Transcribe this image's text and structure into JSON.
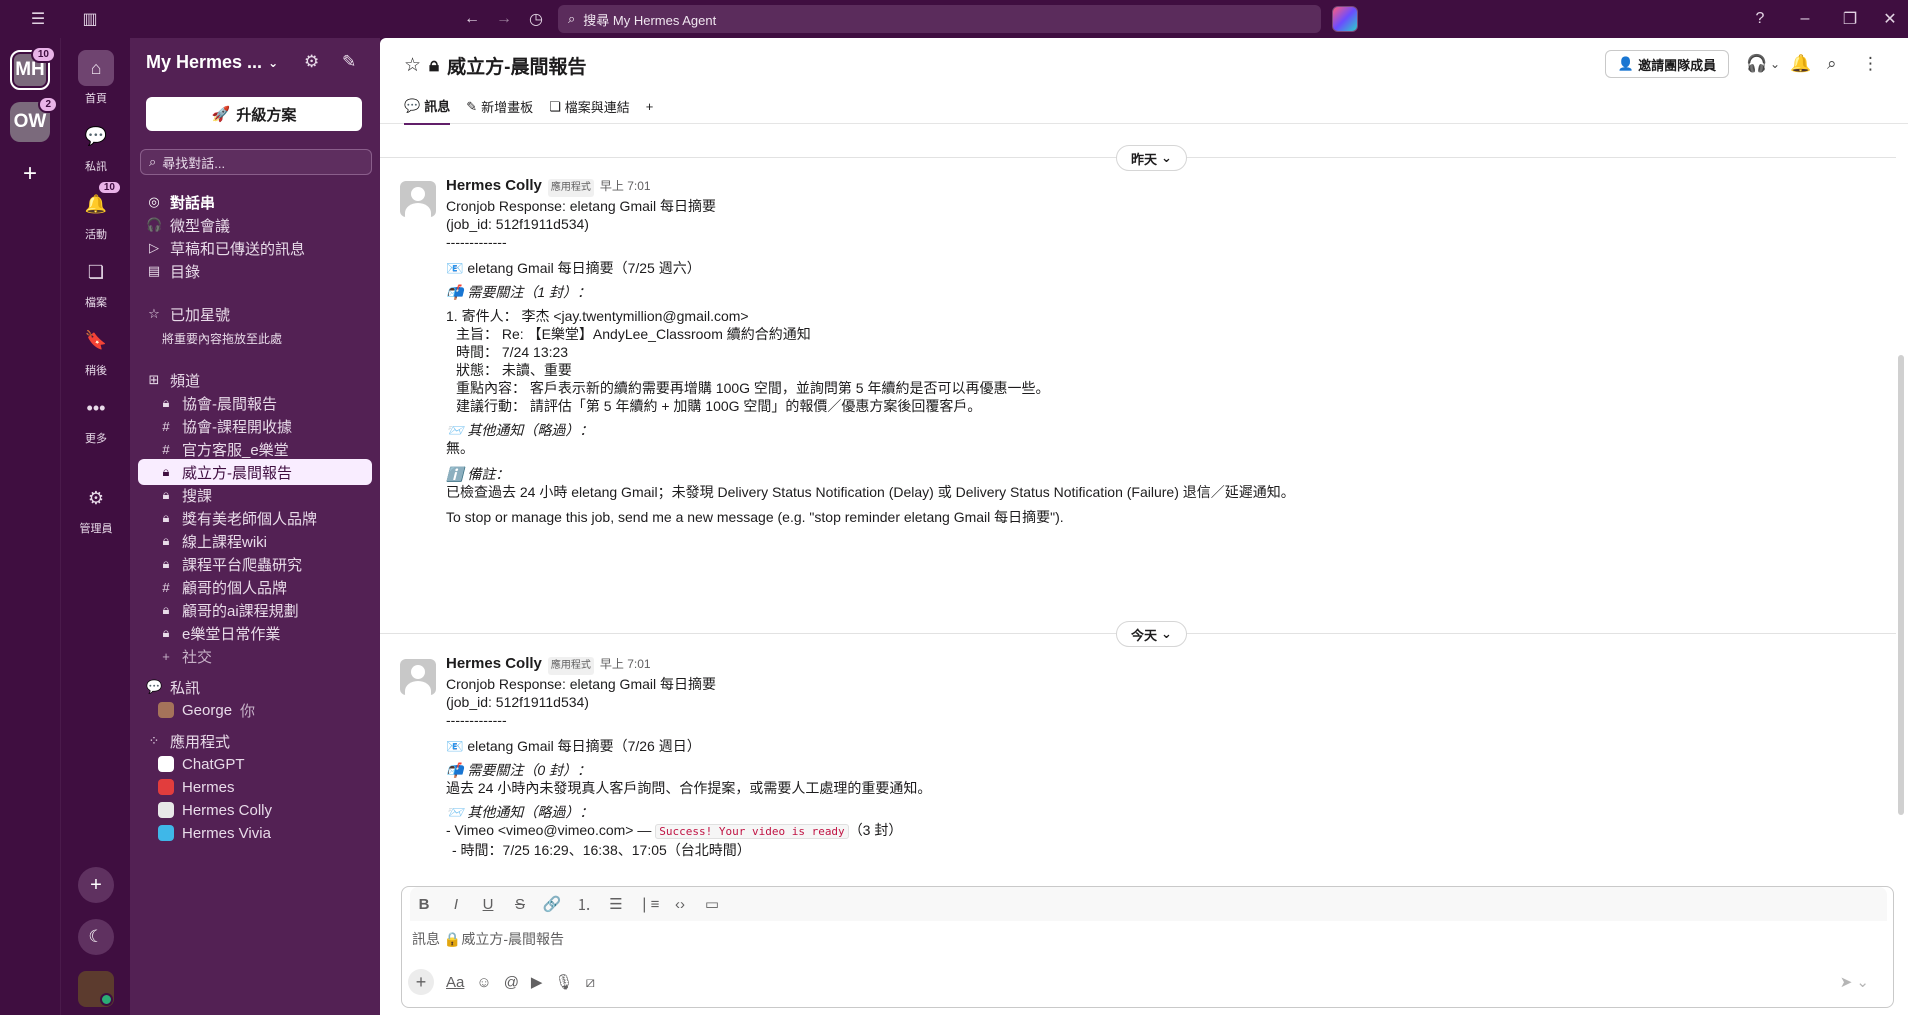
{
  "topbar": {
    "search_placeholder": "搜尋 My Hermes Agent",
    "icons": [
      "hamburger-icon",
      "sidebar-toggle-icon",
      "back-icon",
      "forward-icon",
      "history-icon",
      "help-icon",
      "minimize-icon",
      "maximize-icon",
      "close-icon"
    ]
  },
  "workspaces": [
    {
      "initials": "MH",
      "badge": "10"
    },
    {
      "initials": "OW",
      "badge": "2"
    }
  ],
  "nav": {
    "home": "首頁",
    "dms": "私訊",
    "activity": "活動",
    "activity_badge": "10",
    "files": "檔案",
    "saved": "稍後",
    "more": "更多",
    "admin": "管理員"
  },
  "sidebar": {
    "workspace_name": "My Hermes ...",
    "upgrade_label": "升級方案",
    "find_placeholder": "尋找對話...",
    "top_items": [
      "對話串",
      "微型會議",
      "草稿和已傳送的訊息",
      "目錄"
    ],
    "starred_label": "已加星號",
    "starred_hint": "將重要內容拖放至此處",
    "channels_label": "頻道",
    "channels": [
      {
        "name": "協會-晨間報告",
        "type": "lock"
      },
      {
        "name": "協會-課程開收據",
        "type": "hash"
      },
      {
        "name": "官方客服_e樂堂",
        "type": "hash"
      },
      {
        "name": "威立方-晨間報告",
        "type": "lock",
        "active": true
      },
      {
        "name": "搜課",
        "type": "lock"
      },
      {
        "name": "獎有美老師個人品牌",
        "type": "lock"
      },
      {
        "name": "線上課程wiki",
        "type": "lock"
      },
      {
        "name": "課程平台爬蟲研究",
        "type": "lock"
      },
      {
        "name": "顧哥的個人品牌",
        "type": "hash"
      },
      {
        "name": "顧哥的ai課程規劃",
        "type": "lock"
      },
      {
        "name": "e樂堂日常作業",
        "type": "lock"
      }
    ],
    "add_channel": "社交",
    "dms_label": "私訊",
    "dm_user": "George",
    "dm_user_you": "你",
    "apps_label": "應用程式",
    "apps": [
      {
        "name": "ChatGPT",
        "color": "#ffffff"
      },
      {
        "name": "Hermes",
        "color": "#e23d3d"
      },
      {
        "name": "Hermes Colly",
        "color": "#e8e8e8"
      },
      {
        "name": "Hermes Vivia",
        "color": "#3fb7e8"
      }
    ]
  },
  "channel": {
    "title": "威立方-晨間報告",
    "invite_label": "邀請團隊成員",
    "tabs": [
      "訊息",
      "新增畫板",
      "檔案與連結"
    ]
  },
  "feed": {
    "day1": "昨天",
    "day2": "今天",
    "msg1": {
      "author": "Hermes Colly",
      "tag": "應用程式",
      "time": "早上 7:01",
      "lines": [
        "Cronjob Response: eletang Gmail 每日摘要",
        "(job_id: 512f1911d534)",
        "-------------",
        "📧 eletang Gmail 每日摘要（7/25 週六）",
        "📬 需要關注（1 封）：",
        "1. 寄件人： 李杰 <jay.twentymillion@gmail.com>",
        "主旨： Re: 【E樂堂】AndyLee_Classroom 續約合約通知",
        "時間： 7/24 13:23",
        "狀態： 未讀、重要",
        "重點內容： 客戶表示新的續約需要再增購 100G 空間，並詢問第 5 年續約是否可以再優惠一些。",
        "建議行動： 請評估「第 5 年續約 + 加購 100G 空間」的報價／優惠方案後回覆客戶。",
        "📨 其他通知（略過）：",
        "無。",
        "ℹ️ 備註：",
        "已檢查過去 24 小時 eletang Gmail；未發現 Delivery Status Notification (Delay) 或 Delivery Status Notification (Failure) 退信／延遲通知。",
        "To stop or manage this job, send me a new message (e.g. \"stop reminder eletang Gmail 每日摘要\")."
      ]
    },
    "msg2": {
      "author": "Hermes Colly",
      "tag": "應用程式",
      "time": "早上 7:01",
      "lines": [
        "Cronjob Response: eletang Gmail 每日摘要",
        "(job_id: 512f1911d534)",
        "-------------",
        "📧 eletang Gmail 每日摘要（7/26 週日）",
        "📬 需要關注（0 封）：",
        "過去 24 小時內未發現真人客戶詢問、合作提案，或需要人工處理的重要通知。",
        "📨 其他通知（略過）：",
        "- Vimeo <vimeo@vimeo.com> — ",
        "Success! Your video is ready",
        "（3 封）",
        "- 時間：7/25 16:29、16:38、17:05（台北時間）"
      ]
    }
  },
  "composer": {
    "placeholder": "訊息 🔒威立方-晨間報告",
    "aa": "Aa"
  }
}
